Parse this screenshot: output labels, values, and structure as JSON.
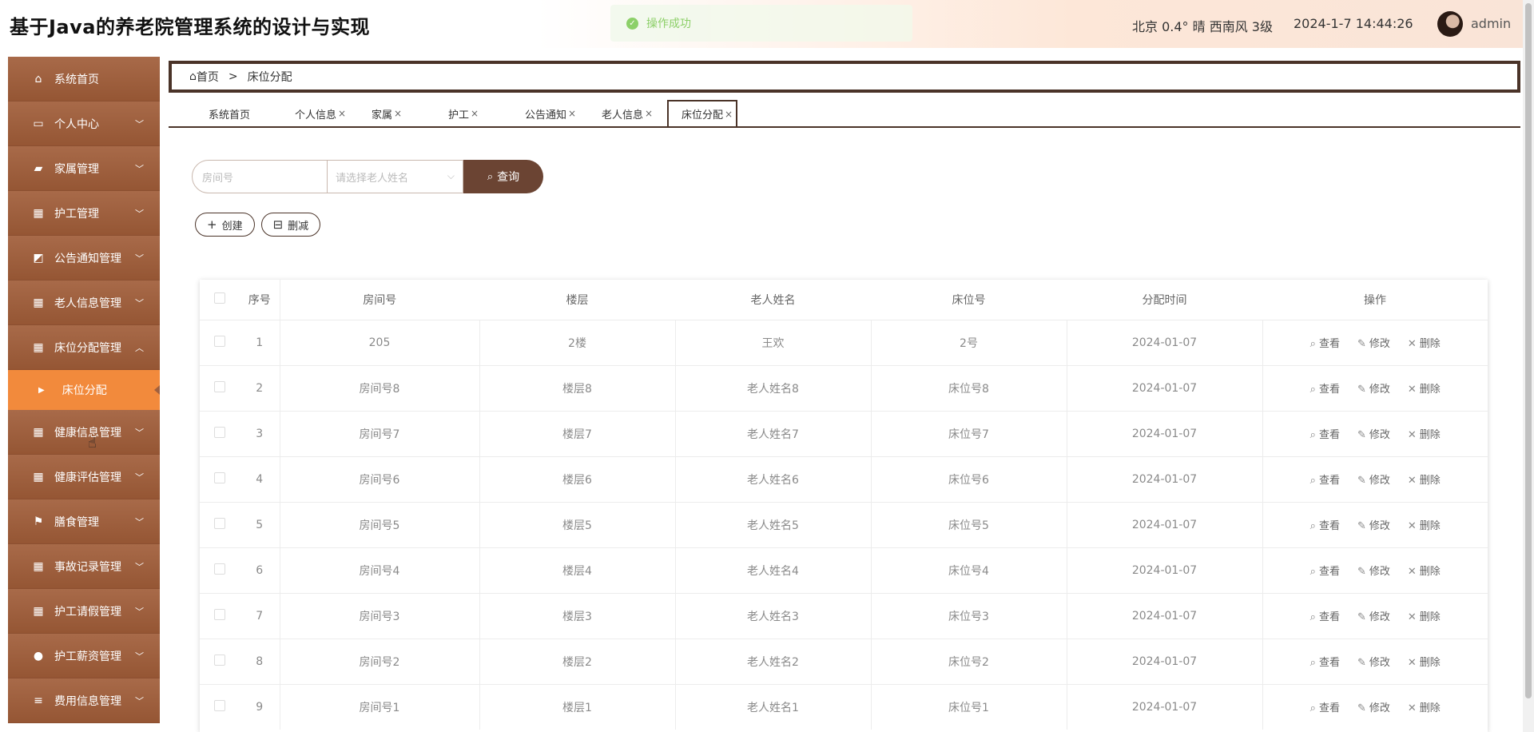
{
  "header": {
    "title": "基于Java的养老院管理系统的设计与实现",
    "toast": "操作成功",
    "weather": "北京  0.4°  晴  西南风  3级",
    "datetime": "2024-1-7 14:44:26",
    "username": "admin"
  },
  "sidebar": {
    "items": [
      {
        "label": "系统首页",
        "icon": "home-icon"
      },
      {
        "label": "个人中心",
        "icon": "id-card-icon"
      },
      {
        "label": "家属管理",
        "icon": "briefcase-icon"
      },
      {
        "label": "护工管理",
        "icon": "grid-icon"
      },
      {
        "label": "公告通知管理",
        "icon": "chart-icon"
      },
      {
        "label": "老人信息管理",
        "icon": "grid-icon"
      },
      {
        "label": "床位分配管理",
        "icon": "grid-icon"
      },
      {
        "label": "健康信息管理",
        "icon": "table-icon"
      },
      {
        "label": "健康评估管理",
        "icon": "grid-icon"
      },
      {
        "label": "膳食管理",
        "icon": "flag-icon"
      },
      {
        "label": "事故记录管理",
        "icon": "grid-icon"
      },
      {
        "label": "护工请假管理",
        "icon": "grid-icon"
      },
      {
        "label": "护工薪资管理",
        "icon": "user-icon"
      },
      {
        "label": "费用信息管理",
        "icon": "sliders-icon"
      }
    ],
    "active_sub": "床位分配"
  },
  "breadcrumb": {
    "home": "首页",
    "sep": ">",
    "current": "床位分配"
  },
  "tabs": [
    "系统首页",
    "个人信息",
    "家属",
    "护工",
    "公告通知",
    "老人信息",
    "床位分配"
  ],
  "tab_close": "×",
  "search": {
    "room_placeholder": "房间号",
    "elder_placeholder": "请选择老人姓名",
    "button": "查询"
  },
  "actions": {
    "create": "创建",
    "delete": "删减"
  },
  "table": {
    "columns": [
      "序号",
      "房间号",
      "楼层",
      "老人姓名",
      "床位号",
      "分配时间",
      "操作"
    ],
    "ops": {
      "view": "查看",
      "edit": "修改",
      "delete": "删除"
    },
    "rows": [
      [
        "1",
        "205",
        "2楼",
        "王欢",
        "2号",
        "2024-01-07"
      ],
      [
        "2",
        "房间号8",
        "楼层8",
        "老人姓名8",
        "床位号8",
        "2024-01-07"
      ],
      [
        "3",
        "房间号7",
        "楼层7",
        "老人姓名7",
        "床位号7",
        "2024-01-07"
      ],
      [
        "4",
        "房间号6",
        "楼层6",
        "老人姓名6",
        "床位号6",
        "2024-01-07"
      ],
      [
        "5",
        "房间号5",
        "楼层5",
        "老人姓名5",
        "床位号5",
        "2024-01-07"
      ],
      [
        "6",
        "房间号4",
        "楼层4",
        "老人姓名4",
        "床位号4",
        "2024-01-07"
      ],
      [
        "7",
        "房间号3",
        "楼层3",
        "老人姓名3",
        "床位号3",
        "2024-01-07"
      ],
      [
        "8",
        "房间号2",
        "楼层2",
        "老人姓名2",
        "床位号2",
        "2024-01-07"
      ],
      [
        "9",
        "房间号1",
        "楼层1",
        "老人姓名1",
        "床位号1",
        "2024-01-07"
      ]
    ]
  }
}
